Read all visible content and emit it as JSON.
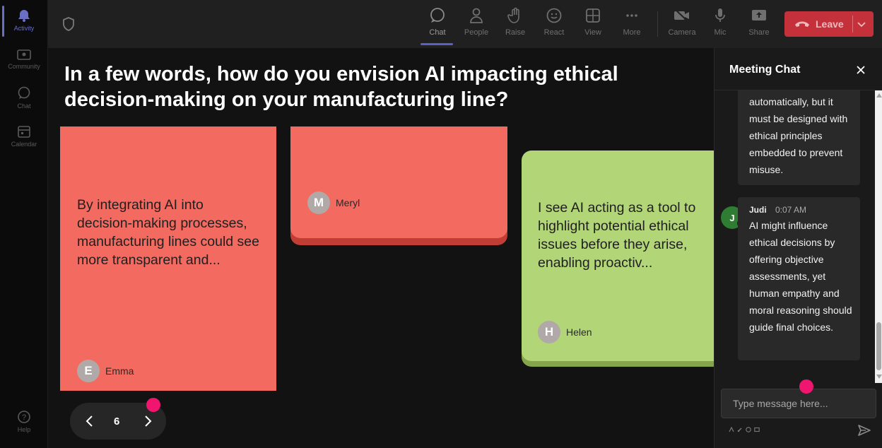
{
  "rail": {
    "items": [
      {
        "label": "Activity",
        "icon": "bell-icon"
      },
      {
        "label": "Community",
        "icon": "community-icon"
      },
      {
        "label": "Chat",
        "icon": "chat-icon"
      },
      {
        "label": "Calendar",
        "icon": "calendar-icon"
      }
    ],
    "help_label": "Help"
  },
  "toolbar": {
    "chat": "Chat",
    "people": "People",
    "raise": "Raise",
    "react": "React",
    "view": "View",
    "more": "More",
    "camera": "Camera",
    "mic": "Mic",
    "share": "Share",
    "leave": "Leave"
  },
  "stage": {
    "question": "In a few words, how do you envision AI impacting ethical decision-making on your manufacturing line?",
    "cards": [
      {
        "text": "By integrating AI into decision-making processes, manufacturing lines could see more transparent and...",
        "author": "Emma",
        "initial": "E",
        "color": "#f26a60"
      },
      {
        "text": "",
        "author": "Meryl",
        "initial": "M",
        "color": "#f26a60"
      },
      {
        "text": "I see AI acting as a tool to highlight potential ethical issues before they arise, enabling proactiv...",
        "author": "Helen",
        "initial": "H",
        "color": "#b2d677"
      }
    ],
    "page_number": "6"
  },
  "chat": {
    "title": "Meeting Chat",
    "messages": [
      {
        "text": "automatically, but it must be designed with ethical principles embedded to prevent misuse."
      },
      {
        "sender": "Judi",
        "initial": "J",
        "time": "0:07 AM",
        "text": "AI might influence ethical decisions by offering objective assessments, yet human empathy and moral reasoning should guide final choices."
      }
    ],
    "input_placeholder": "Type message here..."
  },
  "colors": {
    "accent": "#5b5fc7",
    "leave": "#c4313b",
    "indicator": "#f0166f"
  }
}
